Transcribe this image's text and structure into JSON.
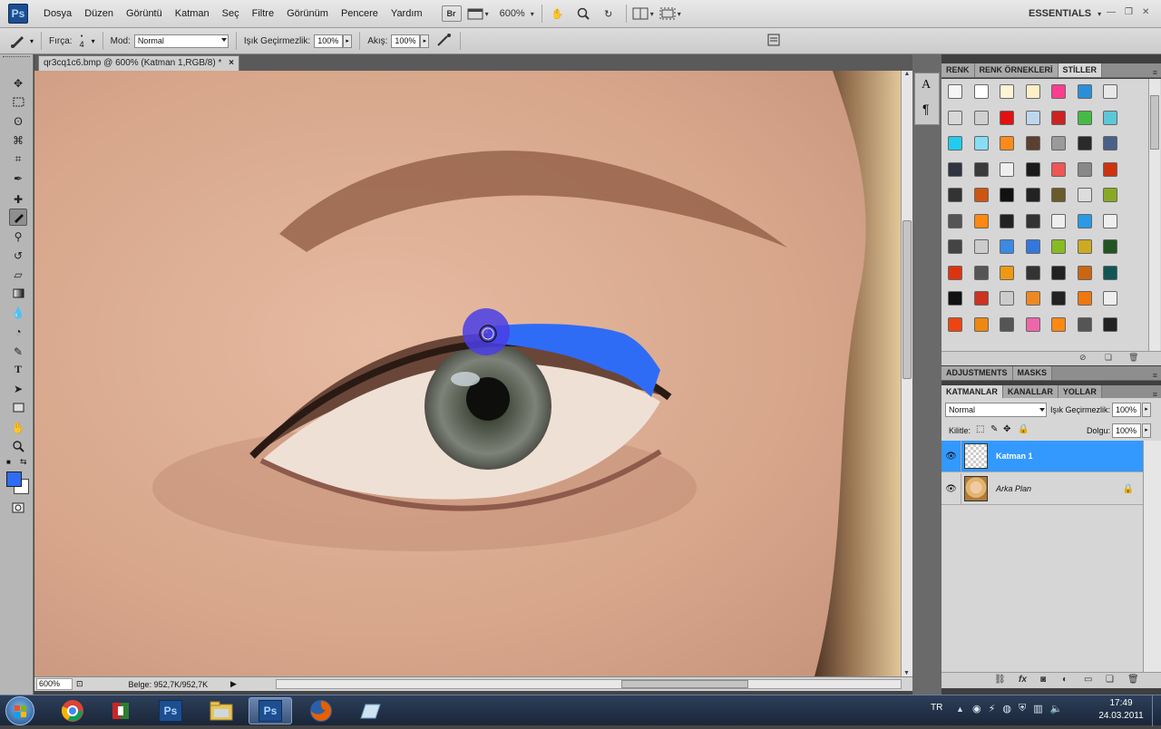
{
  "app": {
    "logo": "Ps"
  },
  "menu": [
    "Dosya",
    "Düzen",
    "Görüntü",
    "Katman",
    "Seç",
    "Filtre",
    "Görünüm",
    "Pencere",
    "Yardım"
  ],
  "appbar": {
    "bridge": "Br",
    "zoom": "600%",
    "workspace": "ESSENTIALS"
  },
  "options": {
    "brush_label": "Fırça:",
    "brush_size": "4",
    "mode_label": "Mod:",
    "mode_value": "Normal",
    "opacity_label": "Işık Geçirmezlik:",
    "opacity_value": "100%",
    "flow_label": "Akış:",
    "flow_value": "100%"
  },
  "document": {
    "tab_title": "qr3cq1c6.bmp @ 600% (Katman 1,RGB/8) *",
    "close": "×",
    "zoom": "600%",
    "doc_info": "Belge: 952,7K/952,7K"
  },
  "colors": {
    "foreground": "#2f6cf5",
    "background": "#ffffff",
    "selection": "#3399ff"
  },
  "panels": {
    "top_tabs": [
      "RENK",
      "RENK ÖRNEKLERİ",
      "STİLLER"
    ],
    "mid_tabs": [
      "ADJUSTMENTS",
      "MASKS"
    ],
    "layers_tabs": [
      "KATMANLAR",
      "KANALLAR",
      "YOLLAR"
    ],
    "blend_mode": "Normal",
    "opacity_label": "Işık Geçirmezlik:",
    "opacity_value": "100%",
    "lock_label": "Kilitle:",
    "fill_label": "Dolgu:",
    "fill_value": "100%",
    "layers": [
      {
        "name": "Katman 1",
        "selected": true
      },
      {
        "name": "Arka Plan",
        "selected": false,
        "locked": true
      }
    ]
  },
  "taskbar": {
    "language": "TR",
    "time": "17:49",
    "date": "24.03.2011",
    "apps": [
      "chrome-icon",
      "winrar-icon",
      "photoshop-icon",
      "explorer-icon",
      "photoshop-active-icon",
      "firefox-icon",
      "folder-icon"
    ]
  }
}
